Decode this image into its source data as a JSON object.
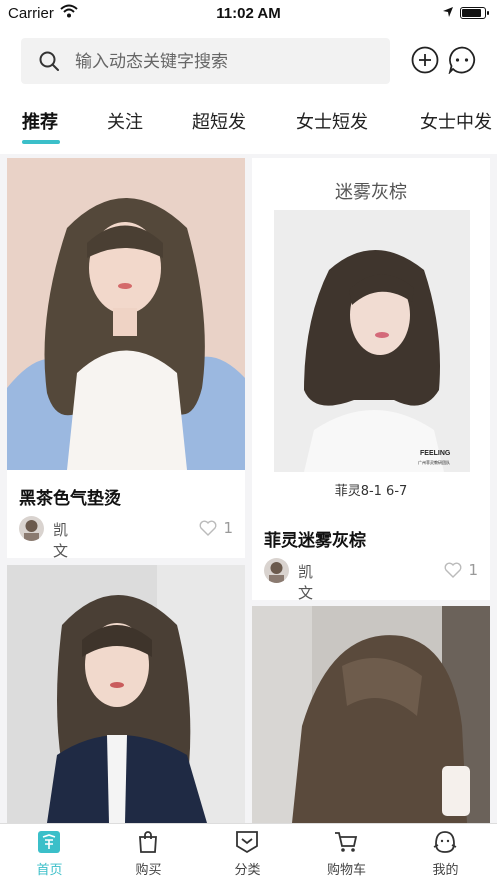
{
  "status_bar": {
    "carrier": "Carrier",
    "time": "11:02 AM",
    "battery_level": 0.9
  },
  "search": {
    "placeholder": "输入动态关键字搜索",
    "value": ""
  },
  "tabs": [
    {
      "label": "推荐",
      "active": true
    },
    {
      "label": "关注",
      "active": false
    },
    {
      "label": "超短发",
      "active": false
    },
    {
      "label": "女士短发",
      "active": false
    },
    {
      "label": "女士中发",
      "active": false
    }
  ],
  "feed": {
    "card1": {
      "title": "黑茶色气垫烫",
      "author": "凯文",
      "likes": "1"
    },
    "card2": {
      "poster_title": "迷雾灰棕",
      "poster_brand": "FEELING",
      "poster_brand_sub": "广州菲灵教研团队",
      "poster_caption": "菲灵8-1 6-7",
      "title": "菲灵迷雾灰棕",
      "author": "凯文",
      "likes": "1"
    }
  },
  "tab_bar": [
    {
      "label": "首页",
      "icon": "home-icon",
      "active": true
    },
    {
      "label": "购买",
      "icon": "shopping-bag-icon",
      "active": false
    },
    {
      "label": "分类",
      "icon": "category-icon",
      "active": false
    },
    {
      "label": "购物车",
      "icon": "cart-icon",
      "active": false
    },
    {
      "label": "我的",
      "icon": "profile-icon",
      "active": false
    }
  ],
  "colors": {
    "accent": "#3bbfc9",
    "background": "#f4f4f6"
  }
}
